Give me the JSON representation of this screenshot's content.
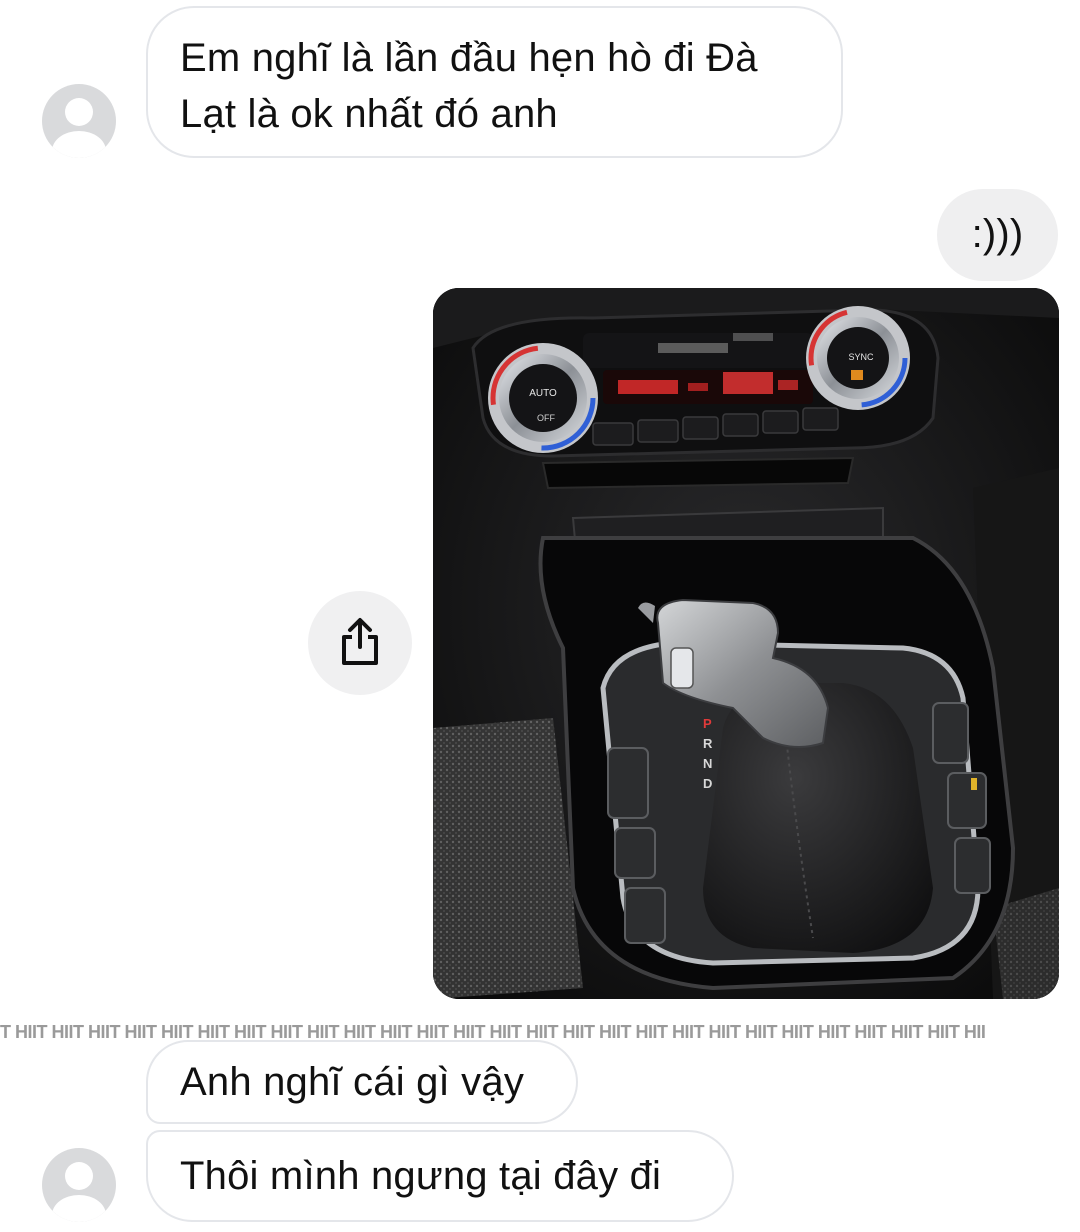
{
  "conversation": {
    "messages": [
      {
        "sender": "them",
        "text": "Em nghĩ là lần đầu hẹn hò đi Đà Lạt là ok nhất đó anh"
      },
      {
        "sender": "me",
        "text": ":)))"
      },
      {
        "sender": "me",
        "type": "photo",
        "subject": "car center console with gear shifter and climate control"
      },
      {
        "sender": "them",
        "text": "Anh nghĩ cái gì vậy"
      },
      {
        "sender": "them",
        "text": "Thôi mình ngưng tại đây đi"
      }
    ]
  },
  "photo": {
    "climate_left_knob_top": "AUTO",
    "climate_left_knob_bottom": "OFF",
    "climate_right_knob_top": "SYNC",
    "gear_letters": [
      "P",
      "R",
      "N",
      "D"
    ]
  },
  "share_button": {
    "icon": "share-icon"
  },
  "watermark": {
    "text": "T HIIT HIIT HIIT HIIT HIIT HIIT HIIT HIIT HIIT HIIT HIIT HIIT HIIT HIIT HIIT HIIT HIIT HIIT HIIT HIIT HIIT HIIT HIIT HIIT HIIT HIIT HII"
  },
  "colors": {
    "incoming_bubble_border": "#e4e6ea",
    "outgoing_bubble_bg": "#efeff0",
    "avatar_bg": "#d9dadc",
    "text": "#111111"
  }
}
